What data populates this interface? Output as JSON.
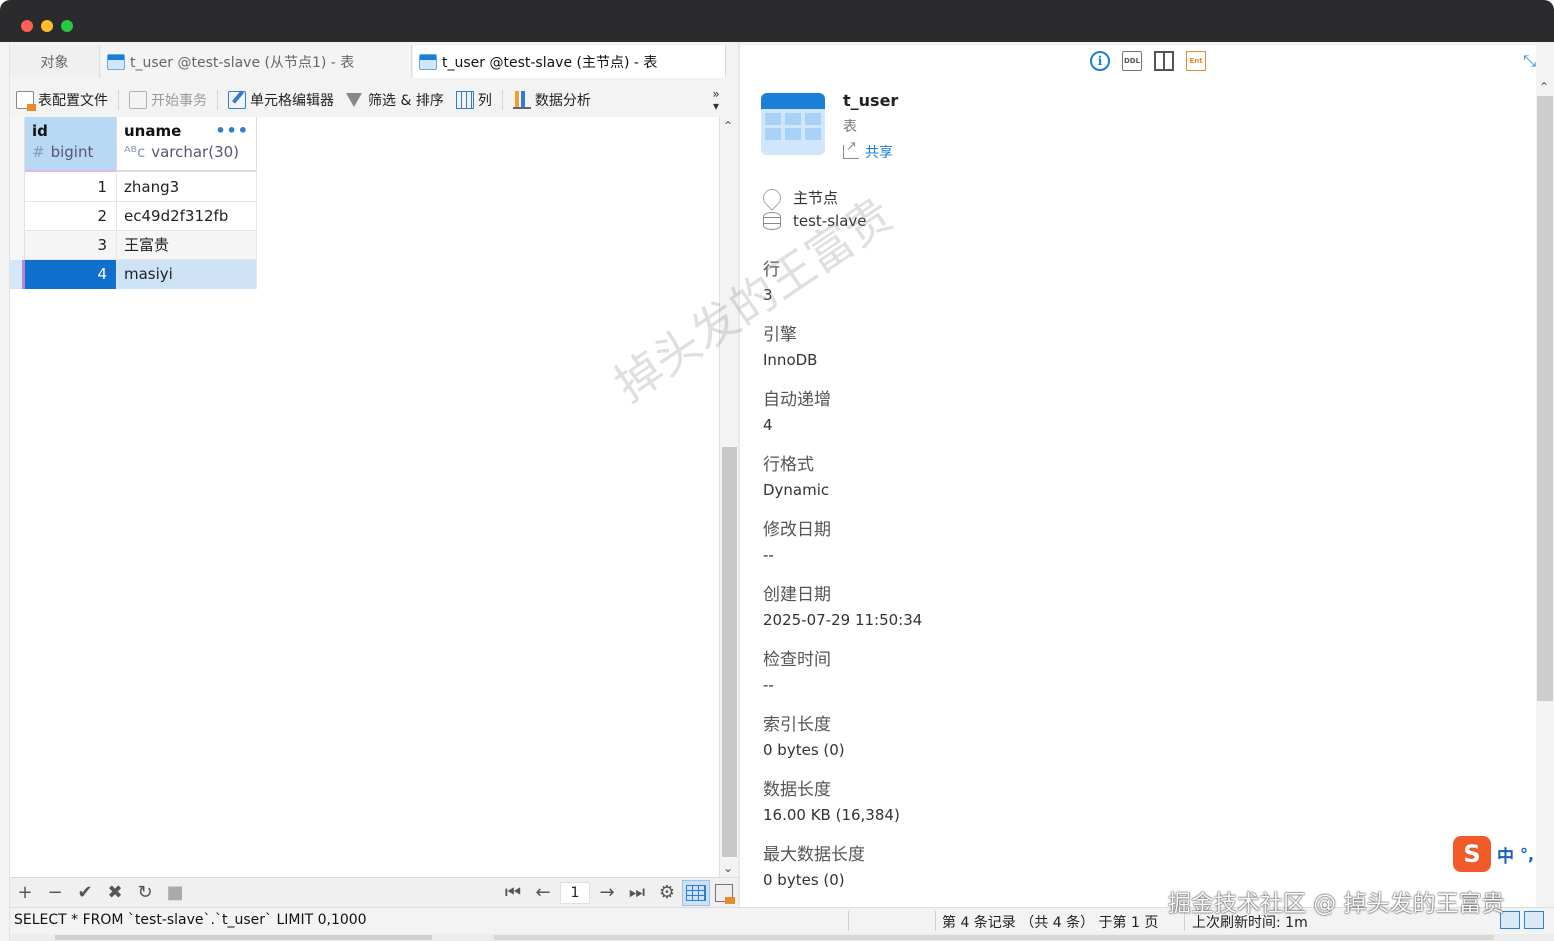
{
  "tabs": [
    {
      "label": "对象"
    },
    {
      "label": "t_user @test-slave (从节点1) - 表"
    },
    {
      "label": "t_user @test-slave (主节点) - 表"
    }
  ],
  "toolbar": {
    "table_profile": "表配置文件",
    "begin_transaction": "开始事务",
    "cell_editor": "单元格编辑器",
    "filter_sort": "筛选 & 排序",
    "columns": "列",
    "data_analysis": "数据分析",
    "more": "»"
  },
  "grid": {
    "columns": [
      {
        "name": "id",
        "type": "bigint",
        "type_symbol": "#"
      },
      {
        "name": "uname",
        "type": "varchar(30)",
        "type_symbol": "ᴬᴮc"
      }
    ],
    "rows": [
      {
        "id": "1",
        "uname": "zhang3"
      },
      {
        "id": "2",
        "uname": "ec49d2f312fb"
      },
      {
        "id": "3",
        "uname": "王富贵"
      },
      {
        "id": "4",
        "uname": "masiyi"
      }
    ],
    "selected_row": 3,
    "header_menu": "•••"
  },
  "nav": {
    "add": "+",
    "delete": "−",
    "apply": "✔",
    "discard": "✖",
    "refresh": "↻",
    "stop": "■",
    "first": "⏮",
    "prev": "←",
    "page": "1",
    "next": "→",
    "last": "⏭",
    "settings": "⚙"
  },
  "status": {
    "sql": "SELECT * FROM `test-slave`.`t_user` LIMIT 0,1000",
    "records": "第 4 条记录 （共 4 条） 于第 1 页",
    "refresh": "上次刷新时间: 1m"
  },
  "info": {
    "top_icons": [
      "info-icon",
      "ddl-icon",
      "layout-icon",
      "ent-icon"
    ],
    "ddl_label": "DDL",
    "ent_label": "Ent",
    "info_glyph": "i",
    "expand_glyph": "⤡",
    "object_name": "t_user",
    "object_type": "表",
    "share": "共享",
    "connection_node": "主节点",
    "database": "test-slave",
    "props": [
      {
        "key": "行",
        "value": "3"
      },
      {
        "key": "引擎",
        "value": "InnoDB"
      },
      {
        "key": "自动递增",
        "value": "4"
      },
      {
        "key": "行格式",
        "value": "Dynamic"
      },
      {
        "key": "修改日期",
        "value": "--"
      },
      {
        "key": "创建日期",
        "value": "2025-07-29 11:50:34"
      },
      {
        "key": "检查时间",
        "value": "--"
      },
      {
        "key": "索引长度",
        "value": "0 bytes (0)"
      },
      {
        "key": "数据长度",
        "value": "16.00 KB (16,384)"
      },
      {
        "key": "最大数据长度",
        "value": "0 bytes (0)"
      }
    ]
  },
  "watermark": "掉头发的王富贵",
  "watermark_bottom": "掘金技术社区 @ 掉头发的王富贵",
  "ime": {
    "logo": "S",
    "lang": "中",
    "punct": "°,"
  },
  "colors": {
    "accent": "#1a7fd6",
    "selection": "#0f6fcc",
    "selection_light": "#cfe3f7",
    "header_selected": "#b9d8f3"
  }
}
